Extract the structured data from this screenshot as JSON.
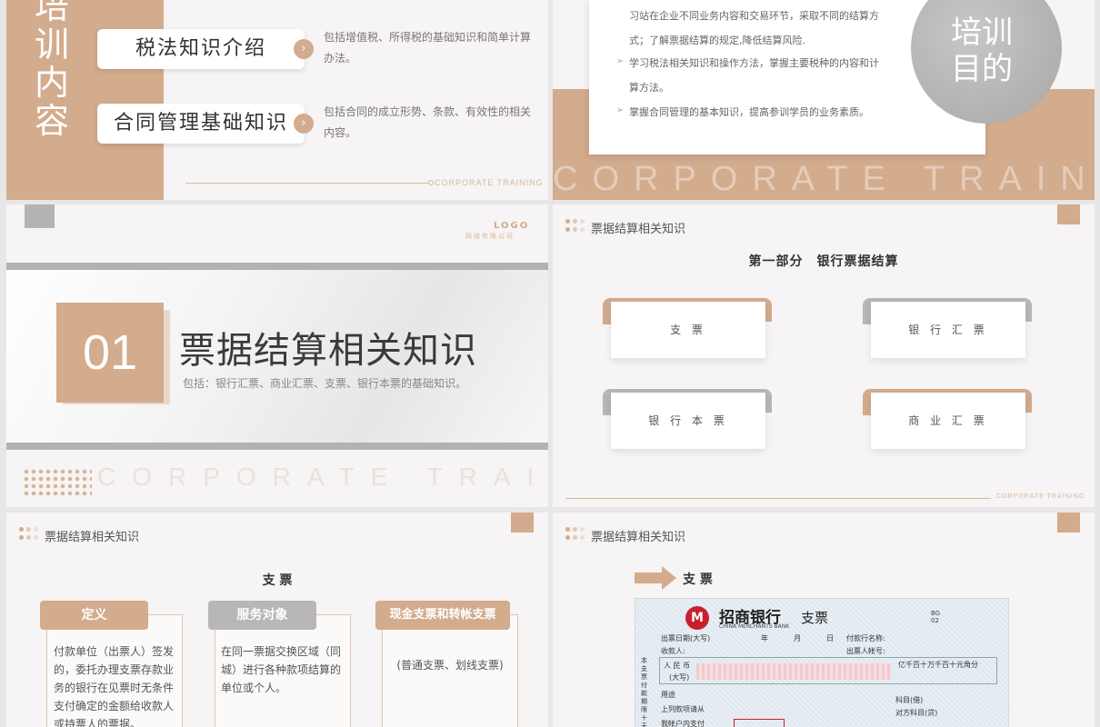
{
  "slide1": {
    "vertical_title": [
      "培",
      "训",
      "内",
      "容"
    ],
    "items": [
      {
        "label": "税法知识介绍",
        "desc": "包括增值税、所得税的基础知识和简单计算办法。"
      },
      {
        "label": "合同管理基础知识",
        "desc": "包括合同的成立形势、条款、有效性的相关内容。"
      }
    ],
    "footer": "CORPORATE TRAINING"
  },
  "slide2": {
    "bullets": [
      "习站在企业不同业务内容和交易环节，采取不同的结算方式；了解票据结算的规定,降低结算风险.",
      "学习税法相关知识和操作方法，掌握主要税种的内容和计算方法。",
      "掌握合同管理的基本知识，提高参训学员的业务素质。"
    ],
    "circle_title": [
      "培训",
      "目的"
    ],
    "watermark": "CORPORATE TRAINING"
  },
  "slide3": {
    "logo": "LOGO",
    "logo_sub": "网络有限公司",
    "number": "01",
    "title": "票据结算相关知识",
    "subtitle": "包括：银行汇票、商业汇票、支票、银行本票的基础知识。",
    "watermark": "CORPORATE TRAINING"
  },
  "slide4": {
    "section": "票据结算相关知识",
    "heading": "第一部分　银行票据结算",
    "cards": [
      "支 票",
      "银 行 汇 票",
      "银 行 本 票",
      "商 业 汇 票"
    ],
    "footer": "CORPORATE TRAINING"
  },
  "slide5": {
    "section": "票据结算相关知识",
    "heading": "支 票",
    "columns": [
      {
        "head": "定义",
        "text": "付款单位（出票人）签发的，委托办理支票存款业务的银行在见票时无条件支付确定的金额给收款人或持票人的票据。",
        "color": "#d3ab8d"
      },
      {
        "head": "服务对象",
        "text": "在同一票据交换区域（同城）进行各种款项结算的单位或个人。",
        "color": "#b8b6b6"
      },
      {
        "head": "现金支票和转帐支票",
        "text": "(普通支票、划线支票)",
        "color": "#d3ab8d"
      }
    ]
  },
  "slide6": {
    "section": "票据结算相关知识",
    "heading": "支 票",
    "cheque": {
      "bank_cn": "招商银行",
      "bank_en": "CHINA MERCHANTS BANK",
      "type": "支票",
      "code": "BG 02",
      "issue_date": "出票日期(大写)",
      "year": "年",
      "month": "月",
      "day": "日",
      "payer_bank": "付款行名称:",
      "payee": "收款人:",
      "account": "出票人帐号:",
      "rmb": "人 民 币",
      "daxie": "(大写)",
      "units": "亿千百十万千百十元角分",
      "side": "本支票付款期限十天",
      "purpose": "用途",
      "above": "上列款项请从",
      "account2": "我帐户内支付",
      "subject_debit": "科目(借)",
      "subject_credit": "对方科目(贷)"
    }
  },
  "colors": {
    "accent": "#d3ab8d",
    "gray": "#b8b6b6",
    "bg": "#f6f4f4"
  }
}
